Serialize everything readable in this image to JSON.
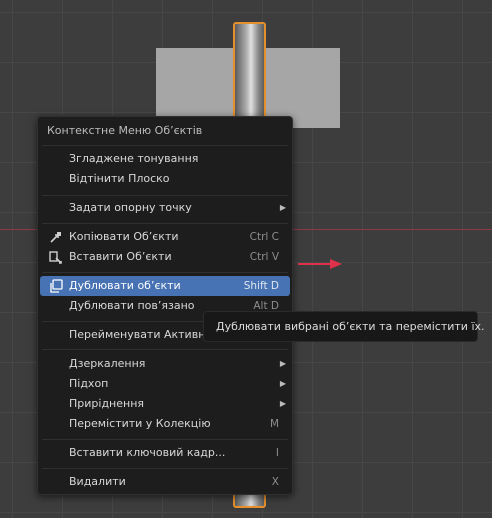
{
  "menu": {
    "title": "Контекстне Меню Об’єктів",
    "items": [
      {
        "label": "Згладжене тонування",
        "shortcut": ""
      },
      {
        "label": "Відтінити Плоско",
        "shortcut": ""
      },
      {
        "label": "Задати опорну точку",
        "submenu": true
      },
      {
        "label": "Копіювати Об’єкти",
        "shortcut": "Ctrl C",
        "icon": "copy-icon"
      },
      {
        "label": "Вставити Об’єкти",
        "shortcut": "Ctrl V",
        "icon": "paste-icon"
      },
      {
        "label": "Дублювати об’єкти",
        "shortcut": "Shift D",
        "icon": "duplicate-icon",
        "active": true
      },
      {
        "label": "Дублювати пов’язано",
        "shortcut": "Alt D"
      },
      {
        "label": "Перейменувати Активни",
        "shortcut": ""
      },
      {
        "label": "Дзеркалення",
        "submenu": true
      },
      {
        "label": "Підхоп",
        "submenu": true
      },
      {
        "label": "Приріднення",
        "submenu": true
      },
      {
        "label": "Перемістити у Колекцію",
        "shortcut": "M"
      },
      {
        "label": "Вставити ключовий кадр...",
        "shortcut": "I"
      },
      {
        "label": "Видалити",
        "shortcut": "X"
      }
    ]
  },
  "tooltip": {
    "text": "Дублювати вибрані об’єкти та перемістити їх."
  },
  "colors": {
    "accent": "#4772b3",
    "selection_outline": "#e6902d",
    "x_axis": "#8c3a44"
  }
}
